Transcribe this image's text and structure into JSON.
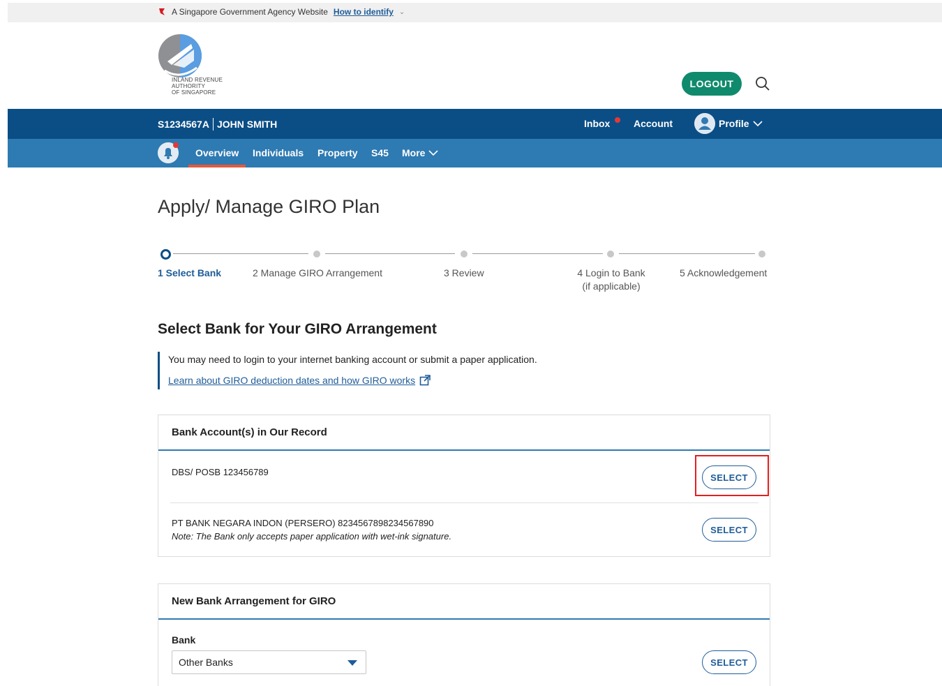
{
  "gov_banner": {
    "text": "A Singapore Government Agency Website",
    "link": "How to identify"
  },
  "header": {
    "logo_text": "INLAND REVENUE\nAUTHORITY\nOF SINGAPORE",
    "logout_label": "LOGOUT",
    "search_icon": "search-icon"
  },
  "user_bar": {
    "user_id": "S1234567A",
    "user_name": "JOHN SMITH",
    "inbox_label": "Inbox",
    "account_label": "Account",
    "profile_label": "Profile"
  },
  "main_nav": {
    "items": [
      {
        "label": "Overview",
        "active": true
      },
      {
        "label": "Individuals"
      },
      {
        "label": "Property"
      },
      {
        "label": "S45"
      },
      {
        "label": "More"
      }
    ]
  },
  "page": {
    "title": "Apply/ Manage GIRO Plan"
  },
  "stepper": {
    "steps": [
      {
        "label": "1 Select Bank",
        "current": true
      },
      {
        "label": "2 Manage GIRO Arrangement"
      },
      {
        "label": "3 Review"
      },
      {
        "label": "4 Login to Bank",
        "sublabel": "(if applicable)"
      },
      {
        "label": "5 Acknowledgement"
      }
    ]
  },
  "select_bank": {
    "heading": "Select Bank for Your GIRO Arrangement",
    "info_text": "You may need to login to your internet banking account or submit a paper application.",
    "info_link": "Learn about GIRO deduction dates and how GIRO works"
  },
  "records_card": {
    "title": "Bank Account(s) in Our Record",
    "accounts": [
      {
        "name": "DBS/ POSB 123456789",
        "button": "SELECT"
      },
      {
        "name": "PT BANK NEGARA INDON (PERSERO) 8234567898234567890",
        "note": "Note: The Bank only accepts paper application with wet-ink signature.",
        "button": "SELECT"
      }
    ]
  },
  "new_card": {
    "title": "New Bank Arrangement for GIRO",
    "field_label": "Bank",
    "selected_bank": "Other Banks",
    "button": "SELECT"
  },
  "colors": {
    "primary_nav": "#0b4e86",
    "secondary_nav": "#2e7ab2",
    "logout_green": "#108a6c",
    "link_blue": "#1f5c99",
    "highlight_red": "#e02020"
  }
}
